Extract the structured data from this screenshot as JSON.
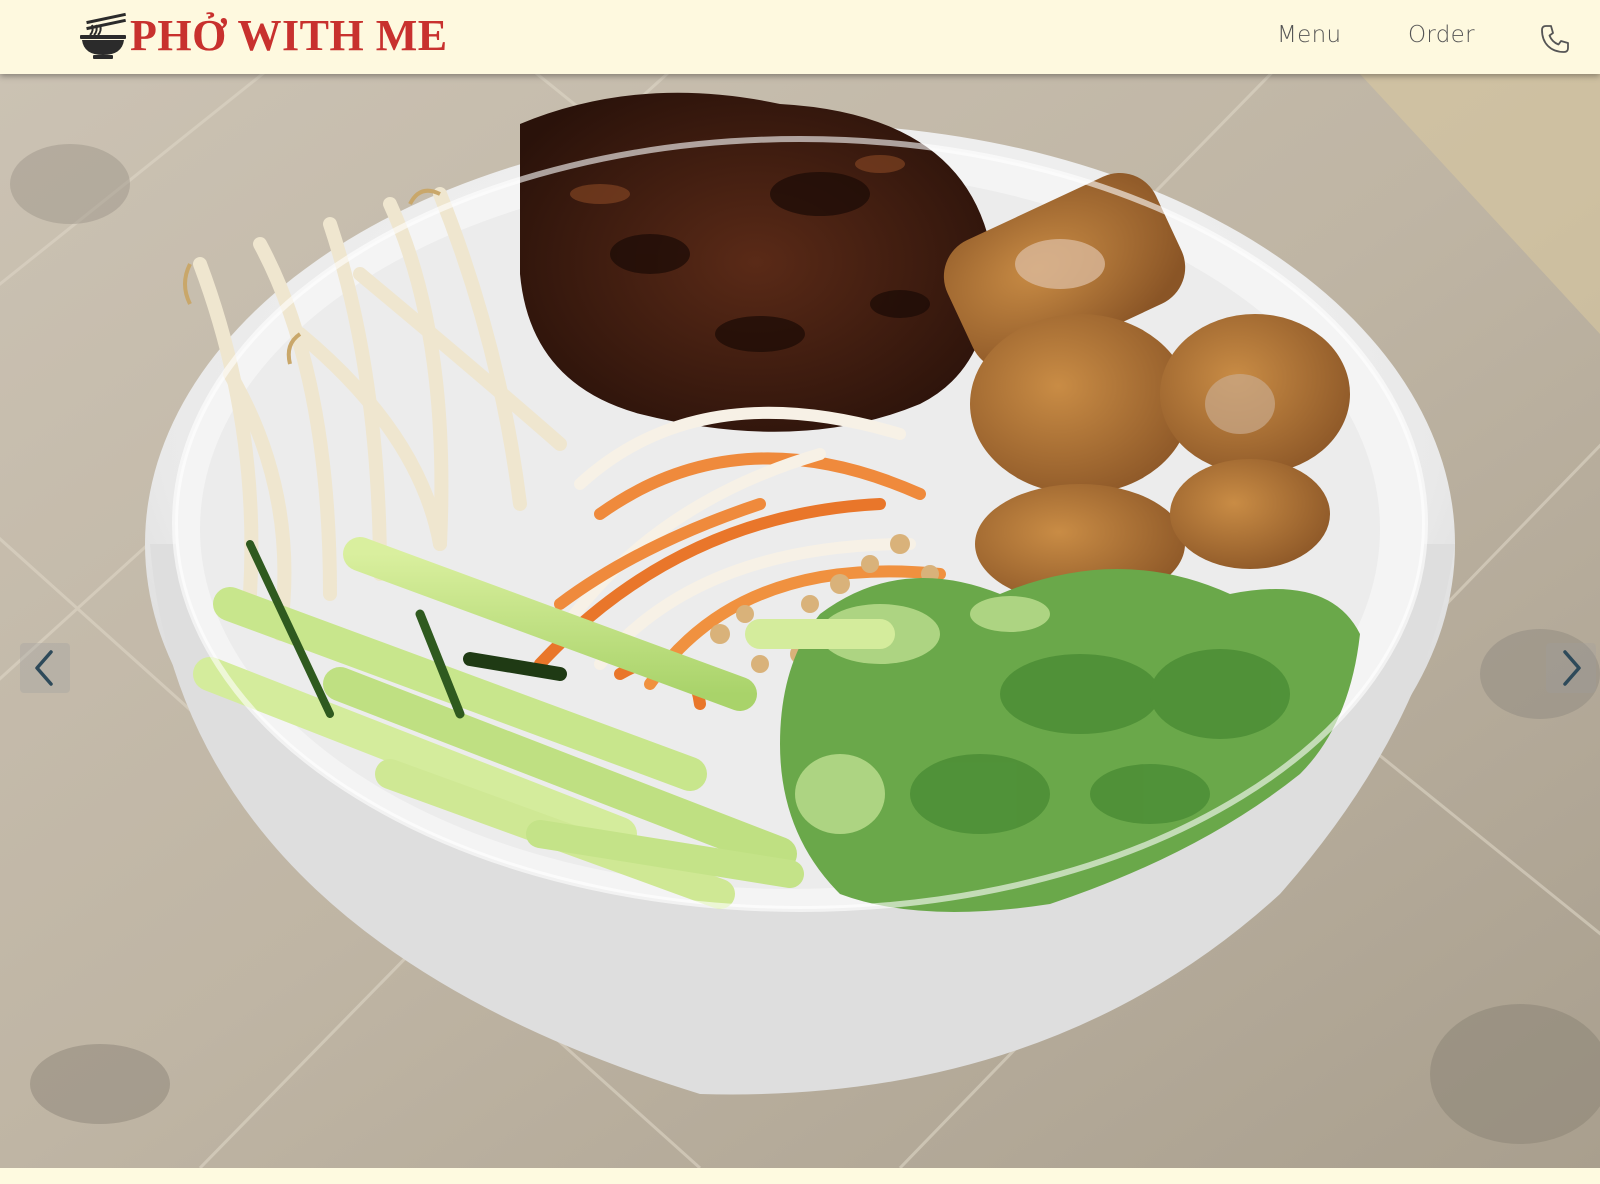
{
  "header": {
    "brand": "PHỞ WITH ME",
    "brand_color": "#c8312e",
    "logo_icon": "noodle-bowl-icon",
    "nav": [
      {
        "label": "Menu"
      },
      {
        "label": "Order"
      }
    ],
    "phone_icon": "phone-icon"
  },
  "hero": {
    "image": "bun-bowl-photo",
    "prev_icon": "chevron-left-icon",
    "next_icon": "chevron-right-icon"
  },
  "colors": {
    "background": "#fefae0",
    "header_bg": "#fef9df",
    "nav_text": "#555555"
  }
}
